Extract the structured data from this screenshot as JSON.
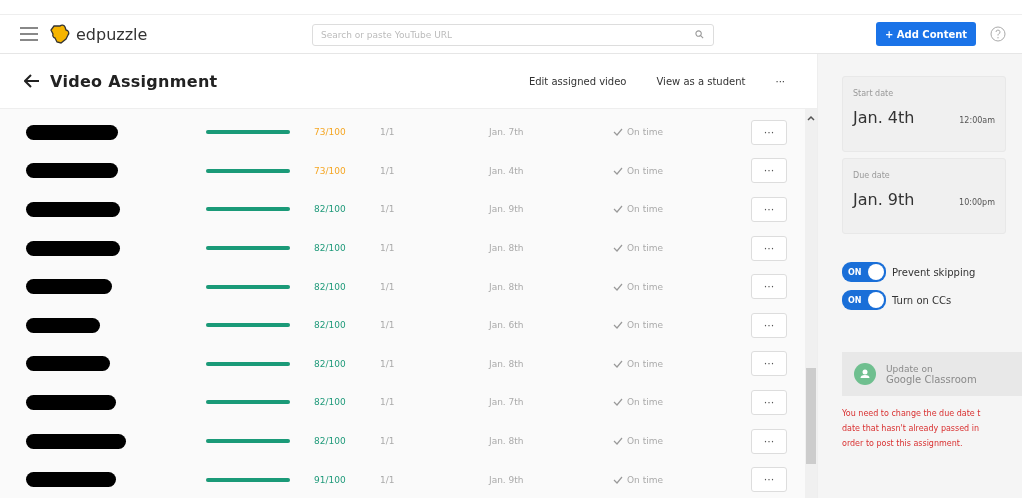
{
  "topbar": {
    "logo": "edpuzzle",
    "search": {
      "placeholder": "Search or paste YouTube URL"
    },
    "add_button": "+ Add Content"
  },
  "header": {
    "title": "Video Assignment",
    "actions": [
      "Edit assigned video",
      "View as a student",
      "···"
    ]
  },
  "rows": [
    {
      "level": 1,
      "score": "73/100",
      "kind": "low",
      "attempts": "1/1",
      "date": "Jan. 7th",
      "status": "On time",
      "menu": "···"
    },
    {
      "level": 1,
      "score": "73/100",
      "kind": "low",
      "attempts": "1/1",
      "date": "Jan. 4th",
      "status": "On time",
      "menu": "···"
    },
    {
      "level": 1,
      "score": "82/100",
      "kind": "pass",
      "attempts": "1/1",
      "date": "Jan. 9th",
      "status": "On time",
      "menu": "···"
    },
    {
      "level": 1,
      "score": "82/100",
      "kind": "pass",
      "attempts": "1/1",
      "date": "Jan. 8th",
      "status": "On time",
      "menu": "···"
    },
    {
      "level": 1,
      "score": "82/100",
      "kind": "pass",
      "attempts": "1/1",
      "date": "Jan. 8th",
      "status": "On time",
      "menu": "···"
    },
    {
      "level": 1,
      "score": "82/100",
      "kind": "pass",
      "attempts": "1/1",
      "date": "Jan. 6th",
      "status": "On time",
      "menu": "···"
    },
    {
      "level": 1,
      "score": "82/100",
      "kind": "pass",
      "attempts": "1/1",
      "date": "Jan. 8th",
      "status": "On time",
      "menu": "···"
    },
    {
      "level": 1,
      "score": "82/100",
      "kind": "pass",
      "attempts": "1/1",
      "date": "Jan. 7th",
      "status": "On time",
      "menu": "···"
    },
    {
      "level": 1,
      "score": "82/100",
      "kind": "pass",
      "attempts": "1/1",
      "date": "Jan. 8th",
      "status": "On time",
      "menu": "···"
    },
    {
      "level": 1,
      "score": "91/100",
      "kind": "pass",
      "attempts": "1/1",
      "date": "Jan. 9th",
      "status": "On time",
      "menu": "···"
    }
  ],
  "sidebar": {
    "dates": [
      {
        "label": "Start date",
        "date": "Jan. 4th",
        "time": "12:00am"
      },
      {
        "label": "Due date",
        "date": "Jan. 9th",
        "time": "10:00pm"
      }
    ],
    "toggles": [
      {
        "label": "Prevent skipping",
        "on": true,
        "on_text": "ON"
      },
      {
        "label": "Turn on CCs",
        "on": true,
        "on_text": "ON"
      }
    ],
    "classroom_button": {
      "lines": [
        "Update on",
        "Google Classroom"
      ],
      "disabled": true
    },
    "error_lines": [
      "You need to change the due date t",
      "date that hasn't already passed in",
      "order to post this assignment."
    ]
  }
}
